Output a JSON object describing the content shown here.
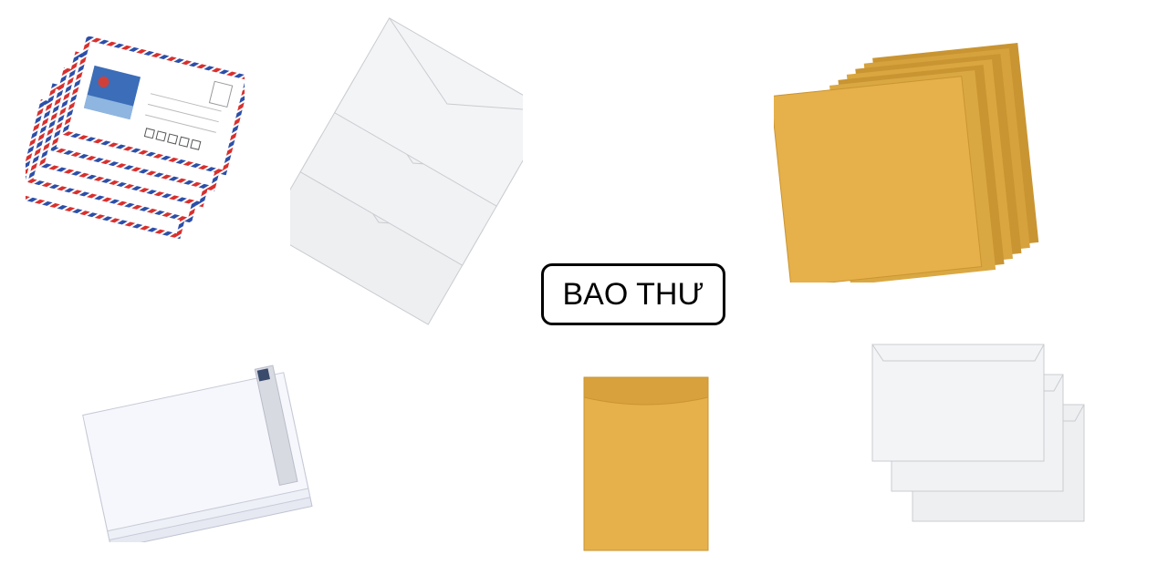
{
  "title": "BAO THƯ",
  "images": [
    {
      "name": "airmail-envelope-stack-icon"
    },
    {
      "name": "white-envelope-trio-icon"
    },
    {
      "name": "kraft-envelope-stack-icon"
    },
    {
      "name": "white-envelope-ream-icon"
    },
    {
      "name": "kraft-envelope-single-icon"
    },
    {
      "name": "white-envelope-trio-small-icon"
    }
  ],
  "colors": {
    "kraft": "#E6B04A",
    "kraft_dark": "#C99532",
    "white_env": "#EEEFF1",
    "white_env_edge": "#C9CCD0",
    "airmail_red": "#D8302E",
    "airmail_blue": "#2C4FA8"
  }
}
